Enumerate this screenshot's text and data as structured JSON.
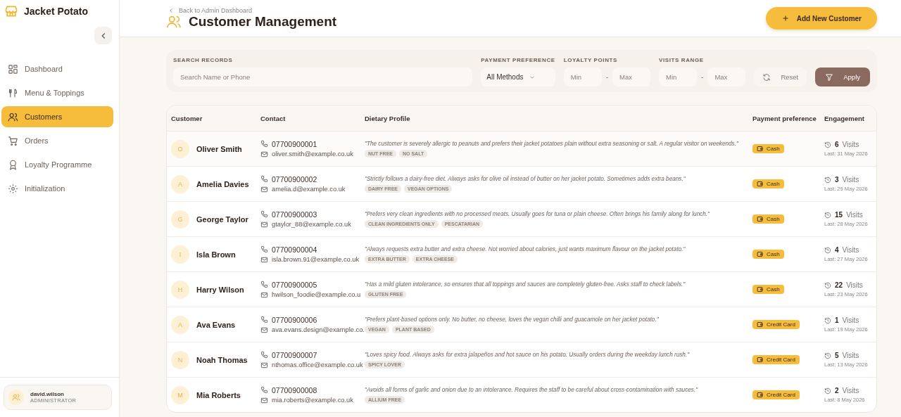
{
  "brand": {
    "name": "Jacket Potato"
  },
  "nav": [
    {
      "label": "Dashboard",
      "selected": false
    },
    {
      "label": "Menu & Toppings",
      "selected": false
    },
    {
      "label": "Customers",
      "selected": true
    },
    {
      "label": "Orders",
      "selected": false
    },
    {
      "label": "Loyalty Programme",
      "selected": false
    },
    {
      "label": "Initialization",
      "selected": false
    }
  ],
  "user": {
    "name": "david.wilson",
    "role": "ADMINISTRATOR"
  },
  "header": {
    "back_link": "Back to Admin Dashboard",
    "title": "Customer Management",
    "add_button": "Add New Customer"
  },
  "filters": {
    "search_label": "SEARCH RECORDS",
    "search_placeholder": "Search Name or Phone",
    "payment_label": "PAYMENT PREFERENCE",
    "payment_value": "All Methods",
    "loyalty_label": "LOYALTY POINTS",
    "visits_label": "VISITS RANGE",
    "loyalty_range": {
      "min": {
        "placeholder": "Min"
      },
      "separator": "-",
      "max": {
        "placeholder": "Max"
      }
    },
    "visits_range": {
      "min": {
        "placeholder": "Min"
      },
      "separator": "-",
      "max": {
        "placeholder": "Max"
      }
    },
    "reset": "Reset",
    "apply": "Apply"
  },
  "table": {
    "columns": [
      "Customer",
      "Contact",
      "Dietary Profile",
      "Payment preference",
      "Engagement"
    ],
    "rows": [
      {
        "initial": "O",
        "name": "Oliver Smith",
        "phone": "07700900001",
        "email": "oliver.smith@example.co.uk",
        "note": "\"The customer is severely allergic to peanuts and prefers their jacket potatoes plain without extra seasoning or salt. A regular visitor on weekends.\"",
        "tags": [
          "NUT FREE",
          "NO SALT"
        ],
        "payment": "Cash",
        "visits": "6",
        "visits_label": "Visits",
        "last": "Last: 31 May 2026"
      },
      {
        "initial": "A",
        "name": "Amelia Davies",
        "phone": "07700900002",
        "email": "amelia.d@example.co.uk",
        "note": "\"Strictly follows a dairy-free diet. Always asks for olive oil instead of butter on her jacket potato. Sometimes adds extra beans.\"",
        "tags": [
          "DAIRY FREE",
          "VEGAN OPTIONS"
        ],
        "payment": "Cash",
        "visits": "3",
        "visits_label": "Visits",
        "last": "Last: 29 May 2026"
      },
      {
        "initial": "G",
        "name": "George Taylor",
        "phone": "07700900003",
        "email": "gtaylor_88@example.co.uk",
        "note": "\"Prefers very clean ingredients with no processed meats. Usually goes for tuna or plain cheese. Often brings his family along for lunch.\"",
        "tags": [
          "CLEAN INGREDIENTS ONLY",
          "PESCATARIAN"
        ],
        "payment": "Cash",
        "visits": "15",
        "visits_label": "Visits",
        "last": "Last: 28 May 2026"
      },
      {
        "initial": "I",
        "name": "Isla Brown",
        "phone": "07700900004",
        "email": "isla.brown.91@example.co.uk",
        "note": "\"Always requests extra butter and extra cheese. Not worried about calories, just wants maximum flavour on the jacket potato.\"",
        "tags": [
          "EXTRA BUTTER",
          "EXTRA CHEESE"
        ],
        "payment": "Cash",
        "visits": "4",
        "visits_label": "Visits",
        "last": "Last: 27 May 2026"
      },
      {
        "initial": "H",
        "name": "Harry Wilson",
        "phone": "07700900005",
        "email": "hwilson_foodie@example.co.u",
        "note": "\"Has a mild gluten intolerance, so ensures that all toppings and sauces are completely gluten-free. Asks staff to check labels.\"",
        "tags": [
          "GLUTEN FREE"
        ],
        "payment": "Cash",
        "visits": "22",
        "visits_label": "Visits",
        "last": "Last: 23 May 2026"
      },
      {
        "initial": "A",
        "name": "Ava Evans",
        "phone": "07700900006",
        "email": "ava.evans.design@example.co.",
        "note": "\"Prefers plant-based options only. No butter, no cheese, loves the vegan chilli and guacamole on her jacket potato.\"",
        "tags": [
          "VEGAN",
          "PLANT BASED"
        ],
        "payment": "Credit Card",
        "visits": "1",
        "visits_label": "Visits",
        "last": "Last: 19 May 2026"
      },
      {
        "initial": "N",
        "name": "Noah Thomas",
        "phone": "07700900007",
        "email": "nthomas.office@example.co.uk",
        "note": "\"Loves spicy food. Always asks for extra jalapeños and hot sauce on his potato. Usually orders during the weekday lunch rush.\"",
        "tags": [
          "SPICY LOVER"
        ],
        "payment": "Credit Card",
        "visits": "5",
        "visits_label": "Visits",
        "last": "Last: 13 May 2026"
      },
      {
        "initial": "M",
        "name": "Mia Roberts",
        "phone": "07700900008",
        "email": "mia.roberts@example.co.uk",
        "note": "\"Avoids all forms of garlic and onion due to an intolerance. Requires the staff to be careful about cross-contamination with sauces.\"",
        "tags": [
          "ALLIUM FREE"
        ],
        "payment": "Credit Card",
        "visits": "2",
        "visits_label": "Visits",
        "last": "Last: 8 May 2026"
      }
    ]
  }
}
